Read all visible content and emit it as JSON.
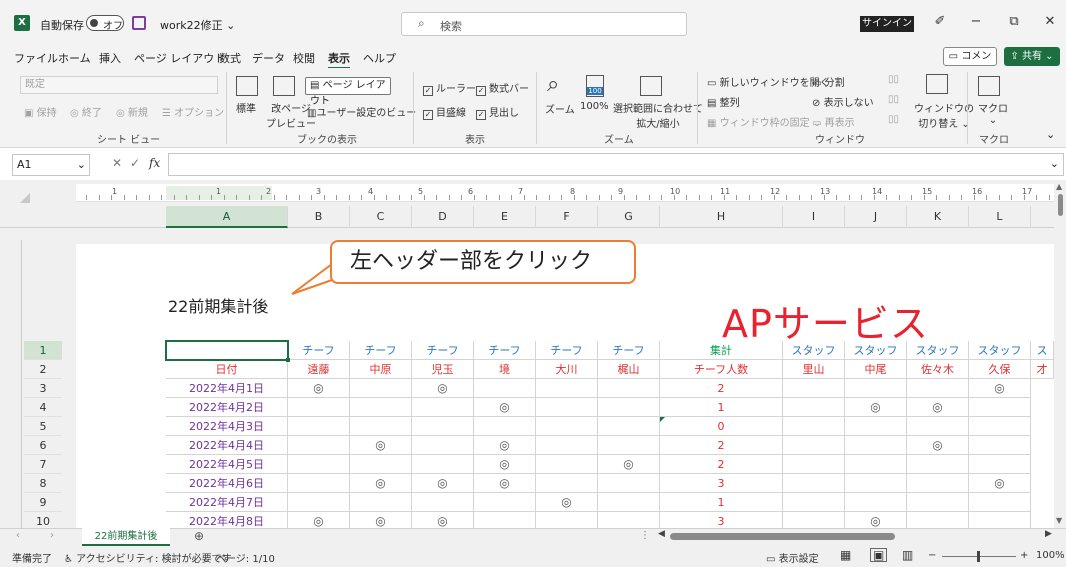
{
  "titlebar": {
    "autosave_label": "自動保存",
    "toggle_state": "オフ",
    "filename": "work22修正",
    "search_placeholder": "検索",
    "signin": "サインイン",
    "minimize": "−",
    "restore": "⧉",
    "close": "✕"
  },
  "menu": {
    "items": [
      "ファイル",
      "ホーム",
      "挿入",
      "ページ レイアウト",
      "数式",
      "データ",
      "校閲",
      "表示",
      "ヘルプ"
    ],
    "active_index": 7,
    "comment_label": "コメント",
    "share_label": "共有"
  },
  "ribbon": {
    "sheetview": {
      "dropdown": "既定",
      "keep": "保持",
      "exit": "終了",
      "new": "新規",
      "options": "オプション",
      "group_label": "シート ビュー"
    },
    "bookview": {
      "normal": "標準",
      "pagebreak_l1": "改ページ",
      "pagebreak_l2": "プレビュー",
      "page_layout": "ページ レイアウト",
      "custom_view": "ユーザー設定のビュー",
      "group_label": "ブックの表示"
    },
    "show": {
      "ruler": "ルーラー",
      "formula_bar": "数式バー",
      "gridlines": "目盛線",
      "headings": "見出し",
      "group_label": "表示"
    },
    "zoom": {
      "zoom": "ズーム",
      "hundred": "100%",
      "icon_text": "100",
      "fit_l1": "選択範囲に合わせて",
      "fit_l2": "拡大/縮小",
      "group_label": "ズーム"
    },
    "window": {
      "new_window": "新しいウィンドウを開く",
      "arrange": "整列",
      "freeze": "ウィンドウ枠の固定",
      "split": "分割",
      "hide": "表示しない",
      "unhide": "再表示",
      "switch_l1": "ウィンドウの",
      "switch_l2": "切り替え",
      "group_label": "ウィンドウ"
    },
    "macro": {
      "label": "マクロ",
      "group_label": "マクロ"
    }
  },
  "formula_bar": {
    "namebox": "A1",
    "fx": "fx",
    "value": ""
  },
  "ruler_numbers": [
    "1",
    "1",
    "2",
    "3",
    "4",
    "5",
    "6",
    "7",
    "8",
    "9",
    "10",
    "11",
    "12",
    "13",
    "14",
    "15",
    "16",
    "17"
  ],
  "columns": [
    "A",
    "B",
    "C",
    "D",
    "E",
    "F",
    "G",
    "H",
    "I",
    "J",
    "K",
    "L"
  ],
  "header_text": "22前期集計後",
  "callout_text": "左ヘッダー部をクリック",
  "aps_text": "APサービス",
  "row_numbers": [
    "1",
    "2",
    "3",
    "4",
    "5",
    "6",
    "7",
    "8",
    "9",
    "10"
  ],
  "row1": [
    "",
    "チーフ",
    "チーフ",
    "チーフ",
    "チーフ",
    "チーフ",
    "チーフ",
    "集計",
    "スタッフ",
    "スタッフ",
    "スタッフ",
    "スタッフ",
    "ス"
  ],
  "row2": [
    "日付",
    "遠藤",
    "中原",
    "児玉",
    "境",
    "大川",
    "梶山",
    "チーフ人数",
    "里山",
    "中尾",
    "佐々木",
    "久保",
    "才"
  ],
  "data_rows": [
    [
      "2022年4月1日",
      "◎",
      "",
      "◎",
      "",
      "",
      "",
      "2",
      "",
      "",
      "",
      "◎"
    ],
    [
      "2022年4月2日",
      "",
      "",
      "",
      "◎",
      "",
      "",
      "1",
      "",
      "◎",
      "◎",
      ""
    ],
    [
      "2022年4月3日",
      "",
      "",
      "",
      "",
      "",
      "",
      "0",
      "",
      "",
      "",
      ""
    ],
    [
      "2022年4月4日",
      "",
      "◎",
      "",
      "◎",
      "",
      "",
      "2",
      "",
      "",
      "◎",
      ""
    ],
    [
      "2022年4月5日",
      "",
      "",
      "",
      "◎",
      "",
      "◎",
      "2",
      "",
      "",
      "",
      ""
    ],
    [
      "2022年4月6日",
      "",
      "◎",
      "◎",
      "◎",
      "",
      "",
      "3",
      "",
      "",
      "",
      "◎"
    ],
    [
      "2022年4月7日",
      "",
      "",
      "",
      "",
      "◎",
      "",
      "1",
      "",
      "",
      "",
      ""
    ],
    [
      "2022年4月8日",
      "◎",
      "◎",
      "◎",
      "",
      "",
      "",
      "3",
      "",
      "◎",
      "",
      ""
    ]
  ],
  "sheet_tab": "22前期集計後",
  "status": {
    "ready": "準備完了",
    "accessibility": "アクセシビリティ: 検討が必要です",
    "page": "ページ: 1/10",
    "display_settings": "表示設定",
    "zoom": "100%"
  }
}
